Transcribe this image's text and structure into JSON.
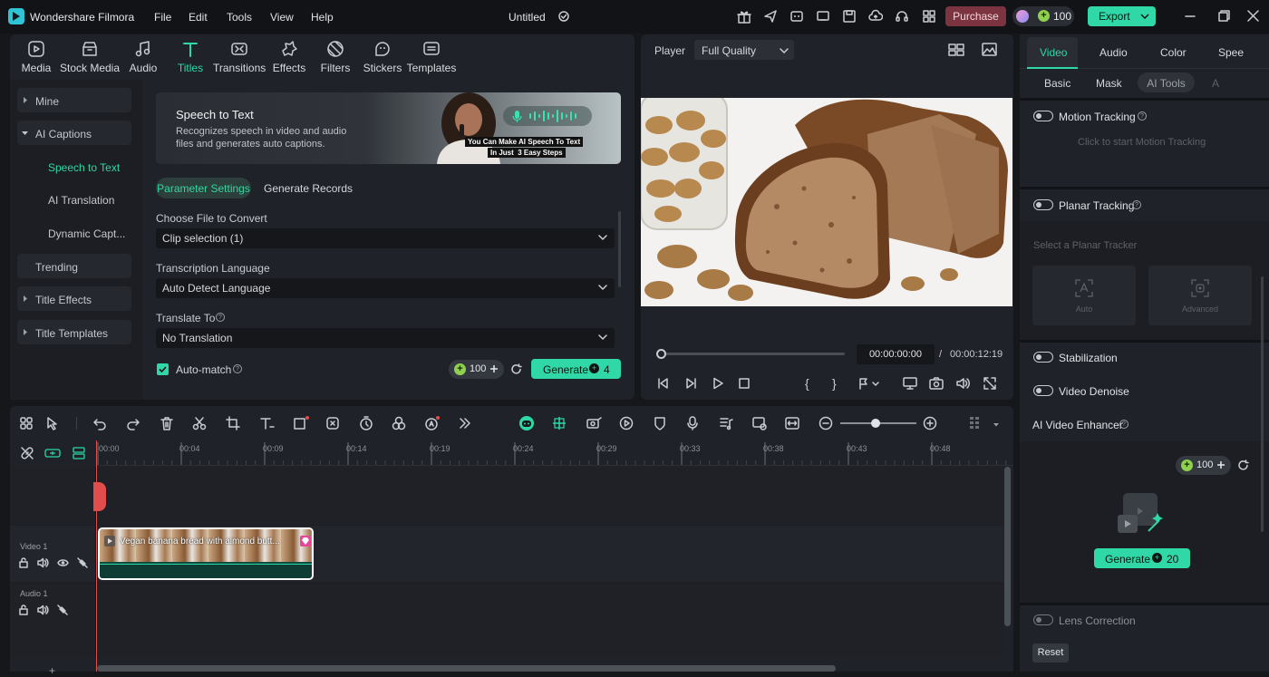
{
  "app": {
    "title": "Wondershare Filmora",
    "project": "Untitled"
  },
  "menu": [
    "File",
    "Edit",
    "Tools",
    "View",
    "Help"
  ],
  "header": {
    "purchase": "Purchase",
    "credits": "100",
    "export": "Export"
  },
  "media_tabs": [
    "Media",
    "Stock Media",
    "Audio",
    "Titles",
    "Transitions",
    "Effects",
    "Filters",
    "Stickers",
    "Templates"
  ],
  "sidebar": {
    "items": [
      {
        "label": "Mine"
      },
      {
        "label": "AI Captions"
      },
      {
        "label": "Speech to Text"
      },
      {
        "label": "AI Translation"
      },
      {
        "label": "Dynamic Capt..."
      },
      {
        "label": "Trending"
      },
      {
        "label": "Title Effects"
      },
      {
        "label": "Title Templates"
      }
    ]
  },
  "stt": {
    "title": "Speech to Text",
    "desc1": "Recognizes speech in video and audio",
    "desc2": "files and generates auto captions.",
    "banner_line1": "You Can Make AI Speech To Text",
    "banner_line2": "In Just  3 Easy Steps",
    "tab_params": "Parameter Settings",
    "tab_records": "Generate Records",
    "file_label": "Choose File to Convert",
    "file_value": "Clip selection (1)",
    "lang_label": "Transcription Language",
    "lang_value": "Auto Detect Language",
    "translate_label": "Translate To",
    "translate_value": "No Translation",
    "automatch": "Auto-match",
    "credits": "100",
    "generate": "Generate",
    "generate_cost": "4"
  },
  "player": {
    "label": "Player",
    "quality": "Full Quality",
    "current": "00:00:00:00",
    "sep": "/",
    "total": "00:00:12:19",
    "progress": 0
  },
  "timeline": {
    "ruler": [
      "00:00",
      "00:04",
      "00:09",
      "00:14",
      "00:19",
      "00:24",
      "00:29",
      "00:33",
      "00:38",
      "00:43",
      "00:48"
    ],
    "video_track": "Video 1",
    "audio_track": "Audio 1",
    "clip_title": "Vegan banana bread with almond butt...",
    "zoom_level": 0.65
  },
  "right": {
    "tabs": [
      "Video",
      "Audio",
      "Color",
      "Spee"
    ],
    "subtabs": [
      "Basic",
      "Mask",
      "AI Tools",
      "A"
    ],
    "motion_tracking": "Motion Tracking",
    "motion_hint": "Click to start Motion Tracking",
    "planar_tracking": "Planar Tracking",
    "planar_hint": "Select a Planar Tracker",
    "auto": "Auto",
    "advanced": "Advanced",
    "stabilization": "Stabilization",
    "video_denoise": "Video Denoise",
    "enhancer": "AI Video Enhancer",
    "credits": "100",
    "generate": "Generate",
    "generate_cost": "20",
    "lens": "Lens Correction",
    "reset": "Reset"
  },
  "colors": {
    "accent": "#2fd8a6",
    "purchase": "#8a3a45",
    "export": "#2fd8a6",
    "playhead": "#e14c4c",
    "clip_border": "#ffffff"
  }
}
